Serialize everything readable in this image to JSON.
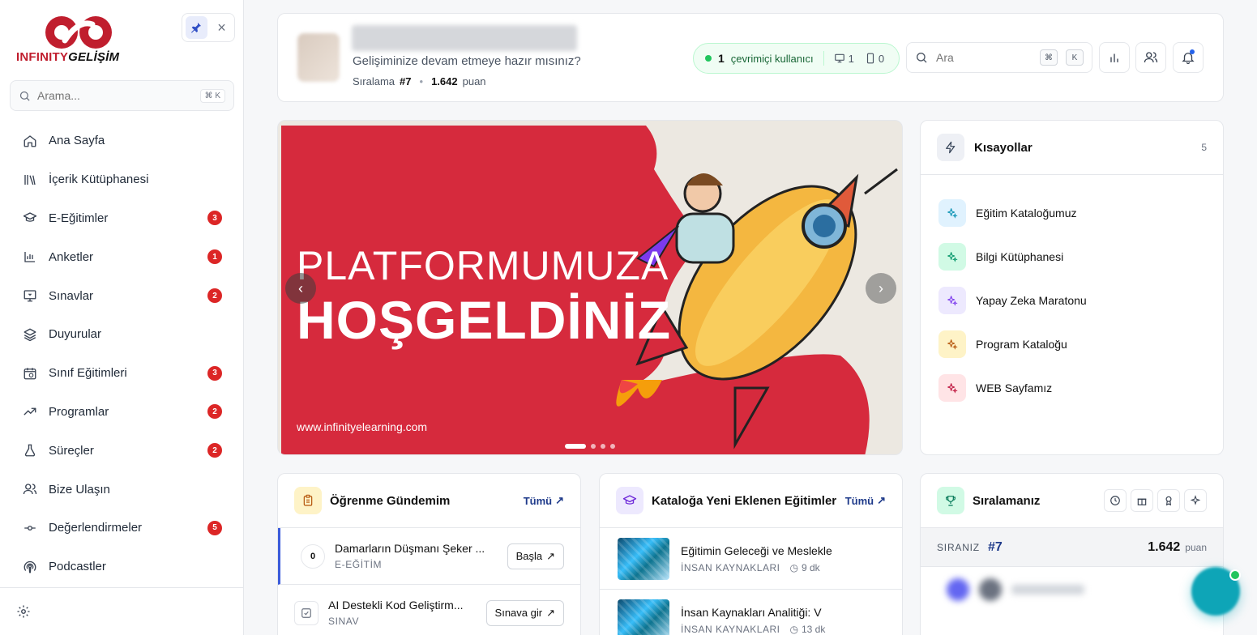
{
  "brand": {
    "name_part1": "INFINITY",
    "name_part2": "GELİŞİM",
    "primary_color": "#c01e2e"
  },
  "sidebar": {
    "search_placeholder": "Arama...",
    "search_shortcut": "⌘ K",
    "items": [
      {
        "label": "Ana Sayfa",
        "icon": "home-icon",
        "badge": null
      },
      {
        "label": "İçerik Kütüphanesi",
        "icon": "library-icon",
        "badge": null
      },
      {
        "label": "E-Eğitimler",
        "icon": "graduation-cap-icon",
        "badge": "3"
      },
      {
        "label": "Anketler",
        "icon": "bar-chart-icon",
        "badge": "1"
      },
      {
        "label": "Sınavlar",
        "icon": "monitor-icon",
        "badge": "2"
      },
      {
        "label": "Duyurular",
        "icon": "layers-icon",
        "badge": null
      },
      {
        "label": "Sınıf Eğitimleri",
        "icon": "calendar-clock-icon",
        "badge": "3"
      },
      {
        "label": "Programlar",
        "icon": "trending-up-icon",
        "badge": "2"
      },
      {
        "label": "Süreçler",
        "icon": "flask-icon",
        "badge": "2"
      },
      {
        "label": "Bize Ulaşın",
        "icon": "users-icon",
        "badge": null
      },
      {
        "label": "Değerlendirmeler",
        "icon": "commit-icon",
        "badge": "5"
      },
      {
        "label": "Podcastler",
        "icon": "podcast-icon",
        "badge": null
      }
    ]
  },
  "header": {
    "subtitle": "Gelişiminize devam etmeye hazır mısınız?",
    "rank_label": "Sıralama",
    "rank_value": "#7",
    "points_value": "1.642",
    "points_label": "puan",
    "online_count": "1",
    "online_label": "çevrimiçi kullanıcı",
    "desktop_count": "1",
    "mobile_count": "0",
    "search_placeholder": "Ara",
    "kbd1": "⌘",
    "kbd2": "K"
  },
  "banner": {
    "line1": "PLATFORMUMUZA",
    "line2": "HOŞGELDİNİZ",
    "url": "www.infinityelearning.com",
    "slide_count": 4,
    "active_slide": 1
  },
  "shortcuts": {
    "title": "Kısayollar",
    "count": "5",
    "items": [
      {
        "label": "Eğitim Kataloğumuz",
        "color": "#0891b2",
        "bg": "#e0f2fe"
      },
      {
        "label": "Bilgi Kütüphanesi",
        "color": "#059669",
        "bg": "#d1fae5"
      },
      {
        "label": "Yapay Zeka Maratonu",
        "color": "#7c3aed",
        "bg": "#ede9fe"
      },
      {
        "label": "Program Kataloğu",
        "color": "#b45309",
        "bg": "#fef3c7"
      },
      {
        "label": "WEB Sayfamız",
        "color": "#be123c",
        "bg": "#ffe4e6"
      }
    ]
  },
  "learning": {
    "title": "Öğrenme Gündemim",
    "all_label": "Tümü",
    "items": [
      {
        "progress": "0",
        "title": "Damarların Düşmanı Şeker ...",
        "type": "E-EĞİTİM",
        "action": "Başla"
      },
      {
        "title": "AI Destekli Kod Geliştirm...",
        "type": "SINAV",
        "action": "Sınava gir"
      }
    ]
  },
  "catalog": {
    "title": "Kataloğa Yeni Eklenen Eğitimler",
    "all_label": "Tümü",
    "items": [
      {
        "title": "Eğitimin Geleceği ve Meslekle",
        "category": "İNSAN KAYNAKLARI",
        "duration": "9 dk"
      },
      {
        "title": "İnsan Kaynakları Analitiği: V",
        "category": "İNSAN KAYNAKLARI",
        "duration": "13 dk"
      }
    ]
  },
  "ranking": {
    "title": "Sıralamanız",
    "your_label": "SIRANIZ",
    "your_position": "#7",
    "your_points": "1.642",
    "points_label": "puan"
  }
}
